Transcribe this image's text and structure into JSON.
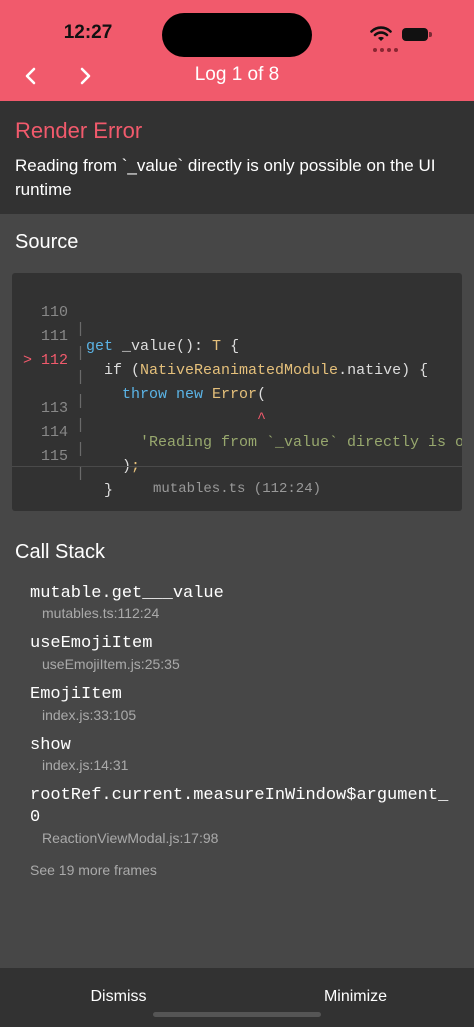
{
  "status": {
    "time": "12:27"
  },
  "header": {
    "title": "Log 1 of 8",
    "bg_color": "#f15a6c"
  },
  "error": {
    "title": "Render Error",
    "message": "Reading from `_value` directly is only possible on the UI runtime"
  },
  "source": {
    "section_title": "Source",
    "lines": [
      {
        "num": "110",
        "marker": "",
        "text": "get _value(): T {"
      },
      {
        "num": "111",
        "marker": "",
        "text": "  if (NativeReanimatedModule.native) {"
      },
      {
        "num": "112",
        "marker": ">",
        "text": "    throw new Error("
      },
      {
        "num": "",
        "marker": "",
        "text": "                   ^"
      },
      {
        "num": "113",
        "marker": "",
        "text": "      'Reading from `_value` directly is o"
      },
      {
        "num": "114",
        "marker": "",
        "text": "    );"
      },
      {
        "num": "115",
        "marker": "",
        "text": "  }"
      }
    ],
    "file_ref": "mutables.ts (112:24)"
  },
  "call_stack": {
    "section_title": "Call Stack",
    "frames": [
      {
        "name": "mutable.get___value",
        "location": "mutables.ts:112:24"
      },
      {
        "name": "useEmojiItem",
        "location": "useEmojiItem.js:25:35"
      },
      {
        "name": "EmojiItem",
        "location": "index.js:33:105"
      },
      {
        "name": "show",
        "location": "index.js:14:31"
      },
      {
        "name": "rootRef.current.measureInWindow$argument_0",
        "location": "ReactionViewModal.js:17:98"
      }
    ],
    "more_label": "See 19 more frames"
  },
  "footer": {
    "dismiss_label": "Dismiss",
    "minimize_label": "Minimize"
  }
}
